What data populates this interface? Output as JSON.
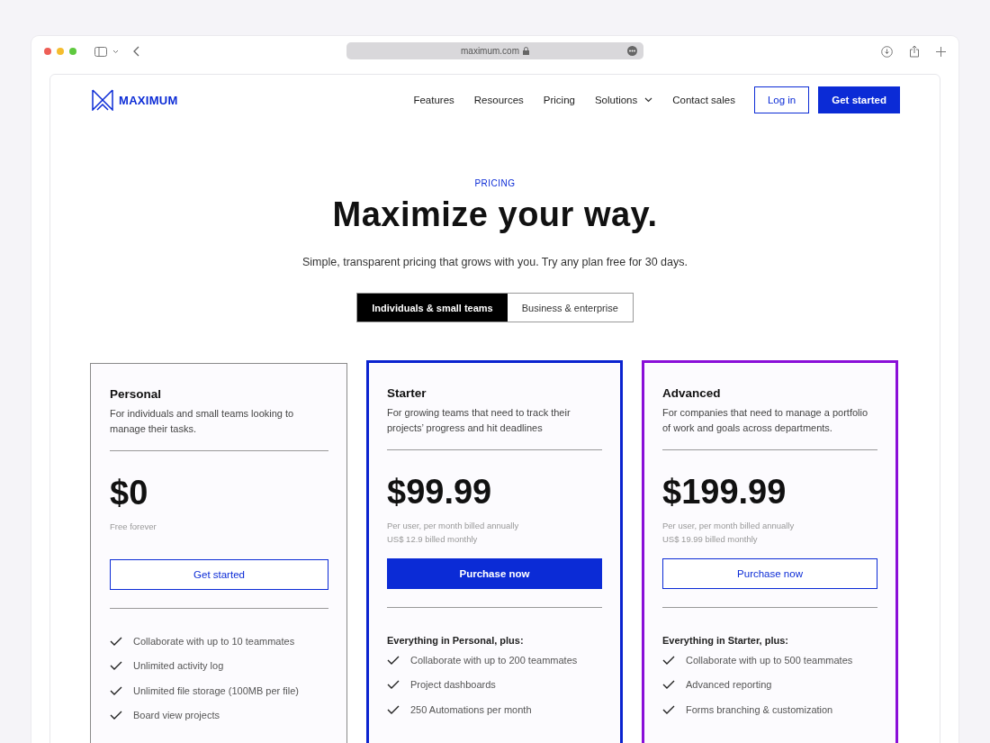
{
  "browser": {
    "address": "maximum.com"
  },
  "nav": {
    "logo": "MAXIMUM",
    "links": [
      {
        "label": "Features",
        "dropdown": false
      },
      {
        "label": "Resources",
        "dropdown": false
      },
      {
        "label": "Pricing",
        "dropdown": false
      },
      {
        "label": "Solutions",
        "dropdown": true
      },
      {
        "label": "Contact sales",
        "dropdown": false
      }
    ],
    "login": "Log in",
    "cta": "Get started"
  },
  "hero": {
    "eyebrow": "PRICING",
    "title": "Maximize your way.",
    "subtitle": "Simple, transparent pricing that grows with you. Try any plan free for 30 days."
  },
  "tabs": [
    {
      "label": "Individuals & small teams",
      "selected": true
    },
    {
      "label": "Business & enterprise",
      "selected": false
    }
  ],
  "plans": [
    {
      "name": "Personal",
      "description": "For individuals and small teams looking to manage their tasks.",
      "price": "$0",
      "notes": [
        "Free forever"
      ],
      "color": "#8a8a8a",
      "button": {
        "label": "Get started",
        "kind": "outline"
      },
      "features": [
        "Collaborate with up to 10 teammates",
        "Unlimited activity log",
        "Unlimited file storage (100MB per file)",
        "Board view projects"
      ]
    },
    {
      "name": "Starter",
      "description": "For growing teams that need to track their projects’ progress and hit deadlines",
      "price": "$99.99",
      "notes": [
        "Per user, per month billed annually",
        "US$ 12.9 billed monthly"
      ],
      "color": "#0a23cf",
      "button": {
        "label": "Purchase now",
        "kind": "filled"
      },
      "features_heading": "Everything in Personal, plus:",
      "features": [
        "Collaborate with up to 200 teammates",
        "Project dashboards",
        "250 Automations per month"
      ]
    },
    {
      "name": "Advanced",
      "description": "For companies that need to manage a portfolio of work and goals across departments.",
      "price": "$199.99",
      "notes": [
        "Per user, per month billed annually",
        "US$ 19.99 billed monthly"
      ],
      "color": "#8a0fd8",
      "button": {
        "label": "Purchase now",
        "kind": "outline"
      },
      "features_heading": "Everything in Starter, plus:",
      "features": [
        "Collaborate with up to 500 teammates",
        "Advanced reporting",
        "Forms branching & customization"
      ]
    }
  ]
}
